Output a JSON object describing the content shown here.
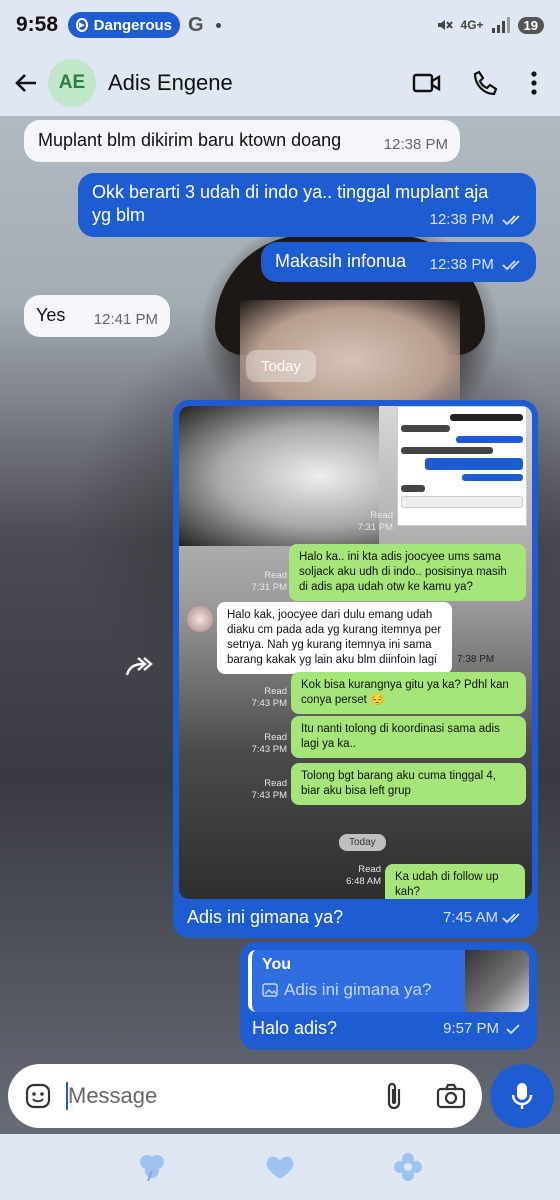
{
  "status_bar": {
    "time": "9:58",
    "media_title": "Dangerous",
    "network": "4G+",
    "battery": "19"
  },
  "header": {
    "avatar_initials": "AE",
    "contact_name": "Adis Engene"
  },
  "messages": [
    {
      "dir": "in",
      "text": "Muplant blm dikirim baru ktown doang",
      "time": "12:38 PM"
    },
    {
      "dir": "out",
      "text": "Okk berarti 3 udah di indo ya.. tinggal muplant aja yg blm",
      "time": "12:38 PM"
    },
    {
      "dir": "out",
      "text": "Makasih infonua",
      "time": "12:38 PM"
    },
    {
      "dir": "in",
      "text": "Yes",
      "time": "12:41 PM"
    }
  ],
  "date_chip": "Today",
  "image_message": {
    "caption": "Adis ini gimana ya?",
    "time": "7:45 AM",
    "screenshot": {
      "green_1": "Halo ka.. ini kta adis joocyee ums sama soljack aku udh di indo.. posisinya masih di adis apa udah otw ke kamu ya?",
      "green_1_meta": "Read\n7:31 PM",
      "white_1": "Halo kak, joocyee dari dulu emang udah diaku cm pada ada yg kurang itemnya per setnya. Nah yg kurang itemnya ini sama barang kakak yg lain aku blm diinfoin lagi",
      "white_1_time": "7:38 PM",
      "green_2": "Kok bisa kurangnya gitu ya ka? Pdhl kan conya perset 😔",
      "green_2_meta": "Read\n7:43 PM",
      "green_3": "Itu nanti tolong di koordinasi sama adis lagi ya ka..",
      "green_3_meta": "Read\n7:43 PM",
      "green_4": "Tolong bgt barang aku cuma tinggal 4, biar aku bisa left grup",
      "green_4_meta": "Read\n7:43 PM",
      "today": "Today",
      "green_5": "Ka udah di follow up kah?",
      "green_5_meta": "Read\n6:48 AM",
      "top_meta": "Read\n7:31 PM"
    }
  },
  "reply_message": {
    "quote_author": "You",
    "quote_text": "Adis ini gimana ya?",
    "text": "Halo adis?",
    "time": "9:57 PM"
  },
  "composer": {
    "placeholder": "Message"
  }
}
